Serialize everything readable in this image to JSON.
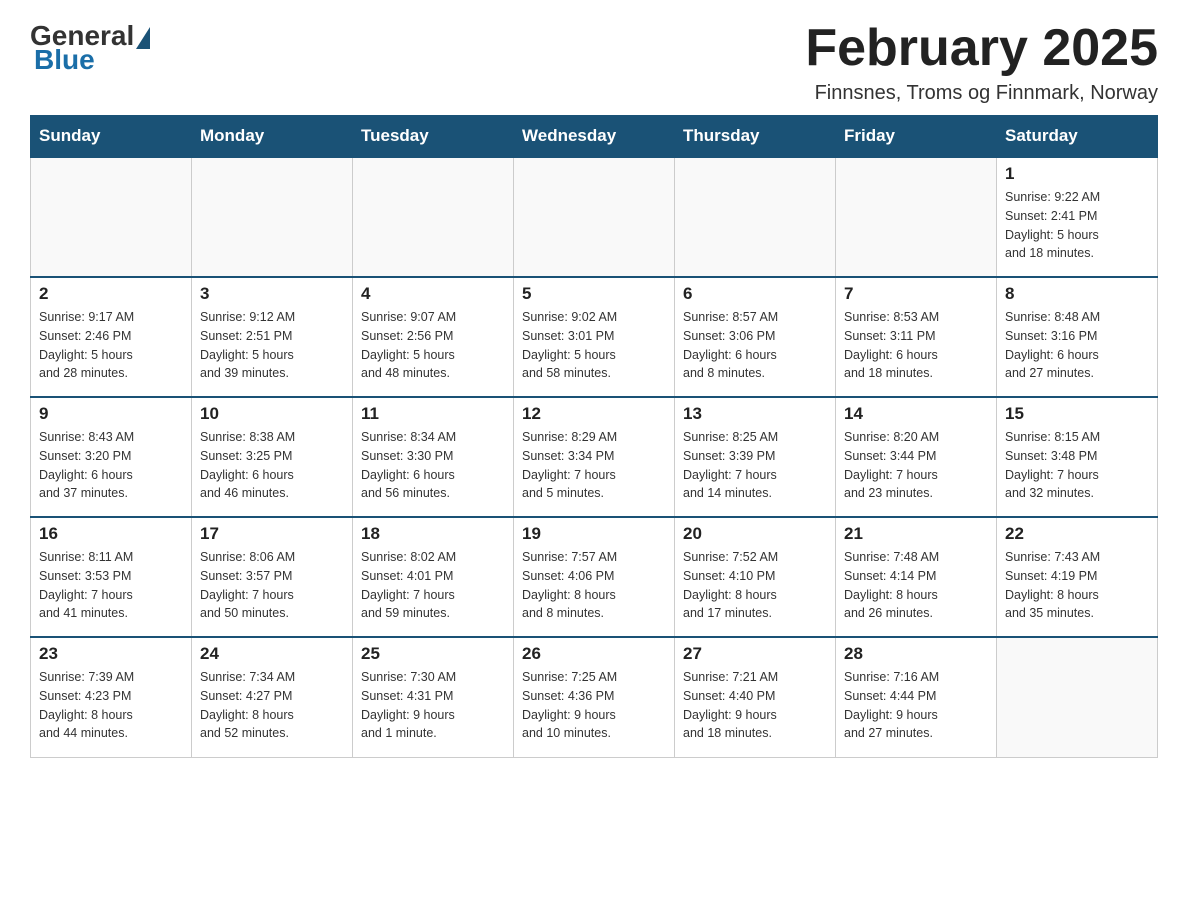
{
  "logo": {
    "general": "General",
    "blue": "Blue"
  },
  "title": "February 2025",
  "location": "Finnsnes, Troms og Finnmark, Norway",
  "days_of_week": [
    "Sunday",
    "Monday",
    "Tuesday",
    "Wednesday",
    "Thursday",
    "Friday",
    "Saturday"
  ],
  "weeks": [
    [
      {
        "day": "",
        "info": ""
      },
      {
        "day": "",
        "info": ""
      },
      {
        "day": "",
        "info": ""
      },
      {
        "day": "",
        "info": ""
      },
      {
        "day": "",
        "info": ""
      },
      {
        "day": "",
        "info": ""
      },
      {
        "day": "1",
        "info": "Sunrise: 9:22 AM\nSunset: 2:41 PM\nDaylight: 5 hours\nand 18 minutes."
      }
    ],
    [
      {
        "day": "2",
        "info": "Sunrise: 9:17 AM\nSunset: 2:46 PM\nDaylight: 5 hours\nand 28 minutes."
      },
      {
        "day": "3",
        "info": "Sunrise: 9:12 AM\nSunset: 2:51 PM\nDaylight: 5 hours\nand 39 minutes."
      },
      {
        "day": "4",
        "info": "Sunrise: 9:07 AM\nSunset: 2:56 PM\nDaylight: 5 hours\nand 48 minutes."
      },
      {
        "day": "5",
        "info": "Sunrise: 9:02 AM\nSunset: 3:01 PM\nDaylight: 5 hours\nand 58 minutes."
      },
      {
        "day": "6",
        "info": "Sunrise: 8:57 AM\nSunset: 3:06 PM\nDaylight: 6 hours\nand 8 minutes."
      },
      {
        "day": "7",
        "info": "Sunrise: 8:53 AM\nSunset: 3:11 PM\nDaylight: 6 hours\nand 18 minutes."
      },
      {
        "day": "8",
        "info": "Sunrise: 8:48 AM\nSunset: 3:16 PM\nDaylight: 6 hours\nand 27 minutes."
      }
    ],
    [
      {
        "day": "9",
        "info": "Sunrise: 8:43 AM\nSunset: 3:20 PM\nDaylight: 6 hours\nand 37 minutes."
      },
      {
        "day": "10",
        "info": "Sunrise: 8:38 AM\nSunset: 3:25 PM\nDaylight: 6 hours\nand 46 minutes."
      },
      {
        "day": "11",
        "info": "Sunrise: 8:34 AM\nSunset: 3:30 PM\nDaylight: 6 hours\nand 56 minutes."
      },
      {
        "day": "12",
        "info": "Sunrise: 8:29 AM\nSunset: 3:34 PM\nDaylight: 7 hours\nand 5 minutes."
      },
      {
        "day": "13",
        "info": "Sunrise: 8:25 AM\nSunset: 3:39 PM\nDaylight: 7 hours\nand 14 minutes."
      },
      {
        "day": "14",
        "info": "Sunrise: 8:20 AM\nSunset: 3:44 PM\nDaylight: 7 hours\nand 23 minutes."
      },
      {
        "day": "15",
        "info": "Sunrise: 8:15 AM\nSunset: 3:48 PM\nDaylight: 7 hours\nand 32 minutes."
      }
    ],
    [
      {
        "day": "16",
        "info": "Sunrise: 8:11 AM\nSunset: 3:53 PM\nDaylight: 7 hours\nand 41 minutes."
      },
      {
        "day": "17",
        "info": "Sunrise: 8:06 AM\nSunset: 3:57 PM\nDaylight: 7 hours\nand 50 minutes."
      },
      {
        "day": "18",
        "info": "Sunrise: 8:02 AM\nSunset: 4:01 PM\nDaylight: 7 hours\nand 59 minutes."
      },
      {
        "day": "19",
        "info": "Sunrise: 7:57 AM\nSunset: 4:06 PM\nDaylight: 8 hours\nand 8 minutes."
      },
      {
        "day": "20",
        "info": "Sunrise: 7:52 AM\nSunset: 4:10 PM\nDaylight: 8 hours\nand 17 minutes."
      },
      {
        "day": "21",
        "info": "Sunrise: 7:48 AM\nSunset: 4:14 PM\nDaylight: 8 hours\nand 26 minutes."
      },
      {
        "day": "22",
        "info": "Sunrise: 7:43 AM\nSunset: 4:19 PM\nDaylight: 8 hours\nand 35 minutes."
      }
    ],
    [
      {
        "day": "23",
        "info": "Sunrise: 7:39 AM\nSunset: 4:23 PM\nDaylight: 8 hours\nand 44 minutes."
      },
      {
        "day": "24",
        "info": "Sunrise: 7:34 AM\nSunset: 4:27 PM\nDaylight: 8 hours\nand 52 minutes."
      },
      {
        "day": "25",
        "info": "Sunrise: 7:30 AM\nSunset: 4:31 PM\nDaylight: 9 hours\nand 1 minute."
      },
      {
        "day": "26",
        "info": "Sunrise: 7:25 AM\nSunset: 4:36 PM\nDaylight: 9 hours\nand 10 minutes."
      },
      {
        "day": "27",
        "info": "Sunrise: 7:21 AM\nSunset: 4:40 PM\nDaylight: 9 hours\nand 18 minutes."
      },
      {
        "day": "28",
        "info": "Sunrise: 7:16 AM\nSunset: 4:44 PM\nDaylight: 9 hours\nand 27 minutes."
      },
      {
        "day": "",
        "info": ""
      }
    ]
  ]
}
